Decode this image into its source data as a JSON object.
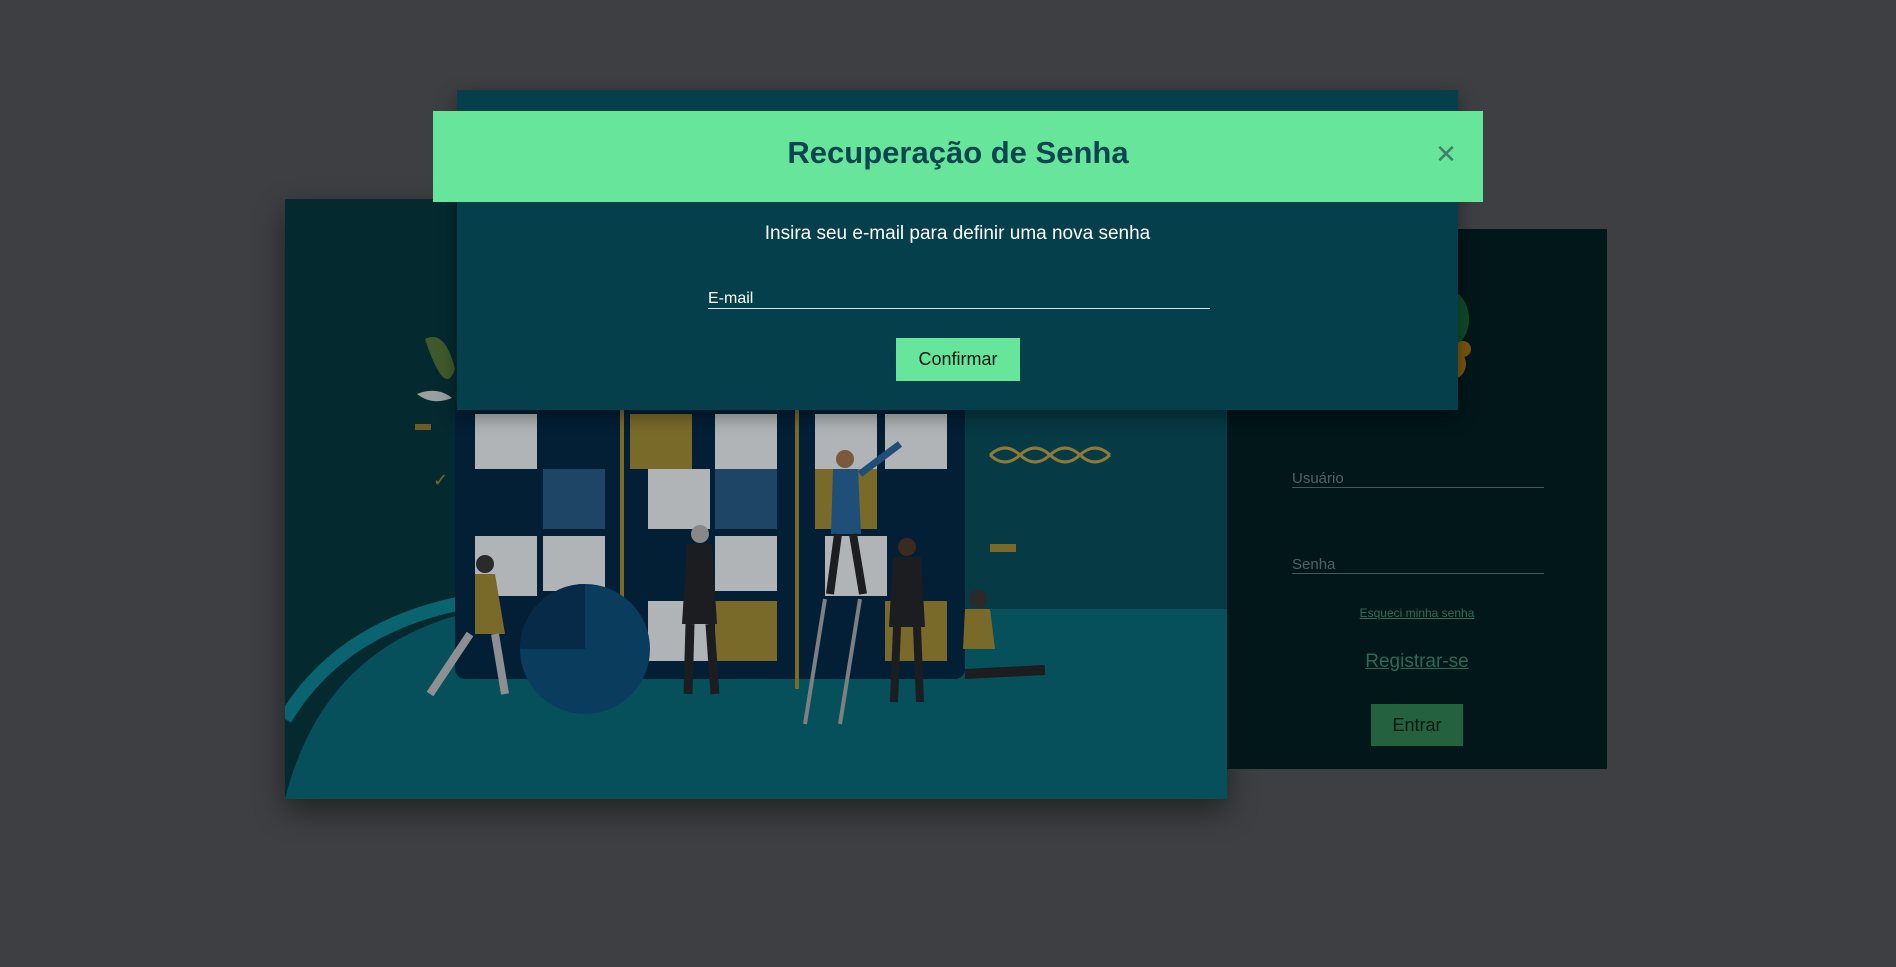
{
  "modal": {
    "title": "Recuperação de Senha",
    "close_icon": "close-icon",
    "description": "Insira seu e-mail para definir uma nova senha",
    "email_label": "E-mail",
    "confirm_label": "Confirmar"
  },
  "login": {
    "username_label": "Usuário",
    "password_label": "Senha",
    "forgot_link": "Esqueci minha senha",
    "register_link": "Registrar-se",
    "enter_label": "Entrar"
  },
  "colors": {
    "page_overlay": "#3d3f42",
    "modal_header": "#67e59b",
    "modal_body": "#053f4b",
    "accent_button": "#67e59b",
    "login_panel": "#01171a"
  }
}
